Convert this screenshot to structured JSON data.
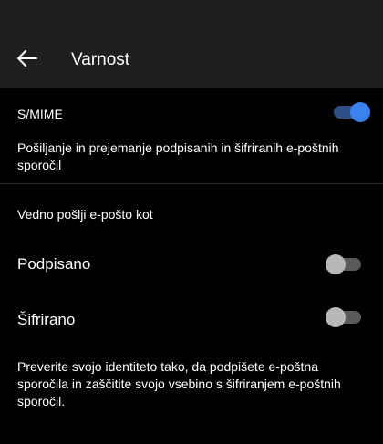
{
  "header": {
    "title": "Varnost",
    "back_icon": "arrow-left-icon"
  },
  "smime": {
    "label": "S/MIME",
    "enabled": true,
    "description": "Pošiljanje in prejemanje podpisanih in šifriranih e-poštnih sporočil"
  },
  "always_send": {
    "heading": "Vedno pošlji e-pošto kot",
    "signed": {
      "label": "Podpisano",
      "enabled": false
    },
    "encrypted": {
      "label": "Šifrirano",
      "enabled": false
    },
    "footer": "Preverite svojo identiteto tako, da podpišete e-poštna sporočila in zaščitite svojo vsebino s šifriranjem e-poštnih sporočil."
  },
  "colors": {
    "toggle_on_thumb": "#3b82f1",
    "toggle_on_track": "#2d4f86",
    "toggle_off_thumb": "#b8b8b8",
    "toggle_off_track": "#5a5a5a",
    "header_bg": "#1f1f1f",
    "page_bg": "#000000"
  }
}
